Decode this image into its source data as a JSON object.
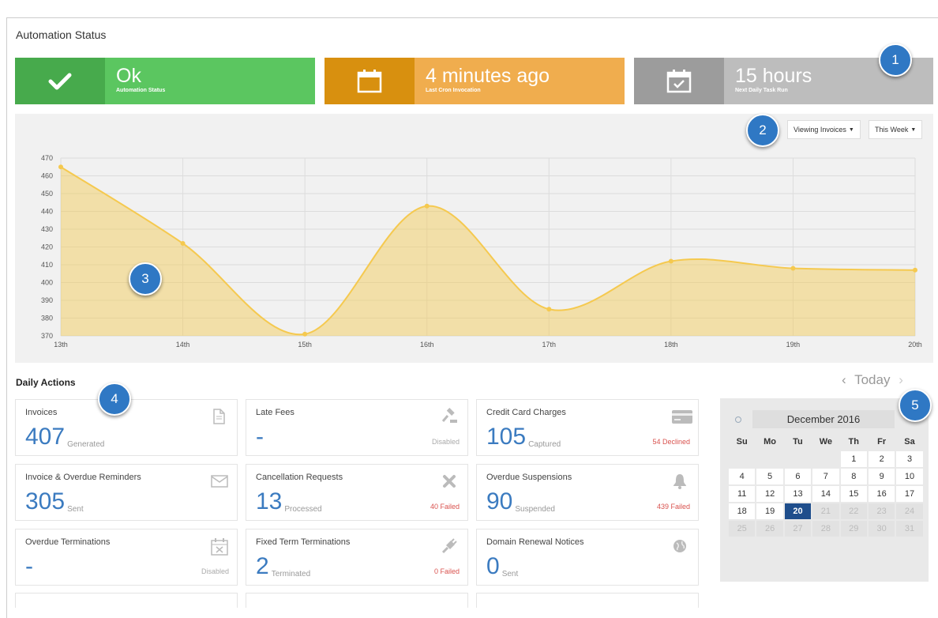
{
  "page": {
    "title": "Automation Status"
  },
  "stats": [
    {
      "value": "Ok",
      "label": "Automation Status",
      "icon": "check-icon"
    },
    {
      "value": "4 minutes ago",
      "label": "Last Cron Invocation",
      "icon": "calendar-icon"
    },
    {
      "value": "15 hours",
      "label": "Next Daily Task Run",
      "icon": "calendar-check-icon"
    }
  ],
  "controls": {
    "viewing": "Viewing Invoices",
    "range": "This Week"
  },
  "badges": [
    "1",
    "2",
    "3",
    "4",
    "5"
  ],
  "colors": {
    "ok": "#5bc660",
    "cron": "#f0ad4e",
    "task": "#bdbdbd",
    "series": "#f5c94f",
    "accent": "#3b7bc0",
    "fail": "#d9534f"
  },
  "chart_data": {
    "type": "area",
    "x": [
      "13th",
      "14th",
      "15th",
      "16th",
      "17th",
      "18th",
      "19th",
      "20th"
    ],
    "series": [
      {
        "values": [
          465,
          422,
          371,
          443,
          385,
          412,
          408,
          407
        ]
      }
    ],
    "ylim": [
      370,
      470
    ],
    "yticks": [
      370,
      380,
      390,
      400,
      410,
      420,
      430,
      440,
      450,
      460,
      470
    ],
    "grid": true
  },
  "daily": {
    "title": "Daily Actions",
    "cards": [
      {
        "title": "Invoices",
        "num": "407",
        "unit": "Generated",
        "foot": "",
        "icon": "document-icon"
      },
      {
        "title": "Late Fees",
        "num": "-",
        "unit": "",
        "foot": "Disabled",
        "icon": "gavel-icon"
      },
      {
        "title": "Credit Card Charges",
        "num": "105",
        "unit": "Captured",
        "foot": "54 Declined",
        "icon": "credit-card-icon"
      },
      {
        "title": "Invoice & Overdue Reminders",
        "num": "305",
        "unit": "Sent",
        "foot": "",
        "icon": "envelope-icon"
      },
      {
        "title": "Cancellation Requests",
        "num": "13",
        "unit": "Processed",
        "foot": "40 Failed",
        "icon": "x-icon"
      },
      {
        "title": "Overdue Suspensions",
        "num": "90",
        "unit": "Suspended",
        "foot": "439 Failed",
        "icon": "bell-icon"
      },
      {
        "title": "Overdue Terminations",
        "num": "-",
        "unit": "",
        "foot": "Disabled",
        "icon": "calendar-x-icon"
      },
      {
        "title": "Fixed Term Terminations",
        "num": "2",
        "unit": "Terminated",
        "foot": "0 Failed",
        "icon": "plug-icon"
      },
      {
        "title": "Domain Renewal Notices",
        "num": "0",
        "unit": "Sent",
        "foot": "",
        "icon": "globe-icon"
      }
    ]
  },
  "calendar": {
    "nav": {
      "prev": "‹",
      "today": "Today",
      "next": "›"
    },
    "month": "December 2016",
    "dow": [
      "Su",
      "Mo",
      "Tu",
      "We",
      "Th",
      "Fr",
      "Sa"
    ],
    "weeks": [
      [
        "",
        "",
        "",
        "",
        "1",
        "2",
        "3"
      ],
      [
        "4",
        "5",
        "6",
        "7",
        "8",
        "9",
        "10"
      ],
      [
        "11",
        "12",
        "13",
        "14",
        "15",
        "16",
        "17"
      ],
      [
        "18",
        "19",
        "20",
        "21",
        "22",
        "23",
        "24"
      ],
      [
        "25",
        "26",
        "27",
        "28",
        "29",
        "30",
        "31"
      ]
    ],
    "today": "20"
  }
}
